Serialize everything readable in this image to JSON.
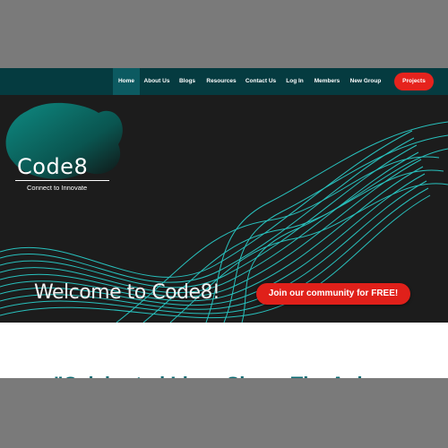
{
  "nav": {
    "items": [
      {
        "label": "Home"
      },
      {
        "label": "About Us"
      },
      {
        "label": "Blogs"
      },
      {
        "label": "Resources"
      },
      {
        "label": "Contact Us"
      },
      {
        "label": "Log In"
      },
      {
        "label": "Members"
      },
      {
        "label": "New Group"
      }
    ],
    "projects_label": "Projects"
  },
  "logo": {
    "name": "Code8",
    "tagline": "Connect to Innovate"
  },
  "hero": {
    "welcome": "Welcome to Code8!",
    "join_label": "Join our community for FREE!"
  },
  "section": {
    "heading_partial": "\"Celebrated Ideas Shape The Ank"
  },
  "colors": {
    "nav_bg": "#053b40",
    "hero_bg": "#1c1c1c",
    "accent_red": "#e6231d",
    "wave_cyan": "#2ad3cf"
  }
}
